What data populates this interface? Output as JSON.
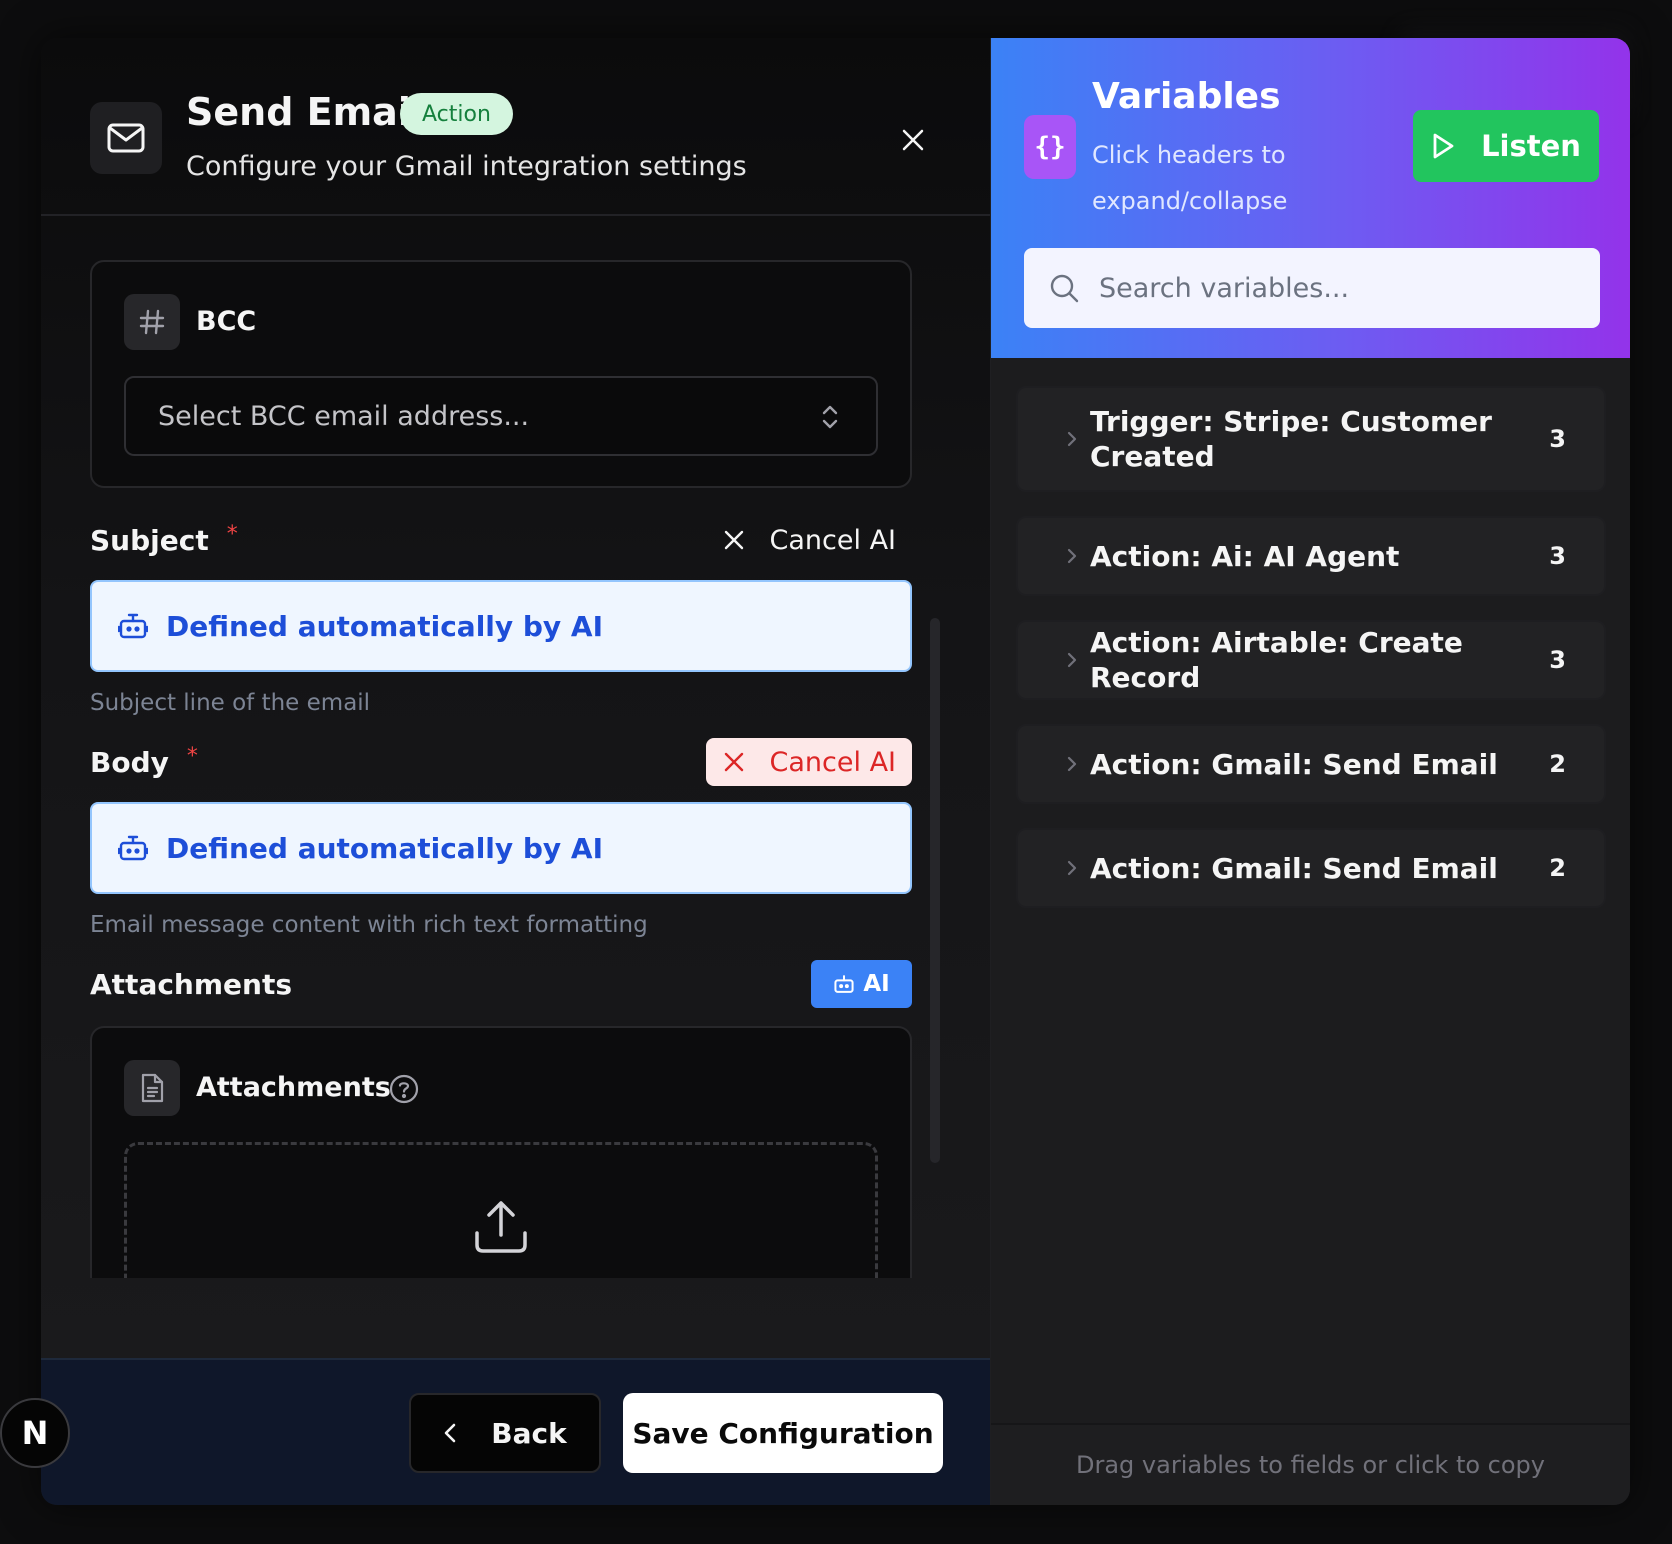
{
  "header": {
    "title": "Send Email",
    "badge": "Action",
    "subtitle": "Configure your Gmail integration settings"
  },
  "bcc": {
    "label": "BCC",
    "placeholder": "Select BCC email address..."
  },
  "subject": {
    "label": "Subject",
    "required_mark": "*",
    "cancel_ai_label": "Cancel AI",
    "ai_value": "Defined automatically by AI",
    "help": "Subject line of the email"
  },
  "body": {
    "label": "Body",
    "required_mark": "*",
    "cancel_ai_label": "Cancel AI",
    "ai_value": "Defined automatically by AI",
    "help": "Email message content with rich text formatting"
  },
  "attachments": {
    "label": "Attachments",
    "ai_button": "AI",
    "card_label": "Attachments"
  },
  "footer": {
    "back_label": "Back",
    "save_label": "Save Configuration"
  },
  "logo": {
    "letter": "N"
  },
  "variables": {
    "icon_text": "{}",
    "title": "Variables",
    "subtitle": "Click headers to expand/collapse",
    "listen_label": "Listen",
    "search_placeholder": "Search variables...",
    "groups": [
      {
        "name": "Trigger: Stripe: Customer Created",
        "count": "3"
      },
      {
        "name": "Action: Ai: AI Agent",
        "count": "3"
      },
      {
        "name": "Action: Airtable: Create Record",
        "count": "3"
      },
      {
        "name": "Action: Gmail: Send Email",
        "count": "2"
      },
      {
        "name": "Action: Gmail: Send Email",
        "count": "2"
      }
    ],
    "footer_hint": "Drag variables to fields or click to copy"
  },
  "colors": {
    "accent_green": "#22c55e",
    "badge_green_bg": "#d4f5df",
    "ai_blue": "#3b82f6",
    "cancel_red": "#dc2626",
    "gradient_start": "#3b82f6",
    "gradient_end": "#9333ea"
  },
  "icons": [
    "mail-icon",
    "close-icon",
    "hash-icon",
    "chevron-up-down-icon",
    "robot-icon",
    "file-text-icon",
    "help-circle-icon",
    "upload-icon",
    "chevron-left-icon",
    "braces-icon",
    "play-icon",
    "search-icon",
    "chevron-right-icon"
  ]
}
